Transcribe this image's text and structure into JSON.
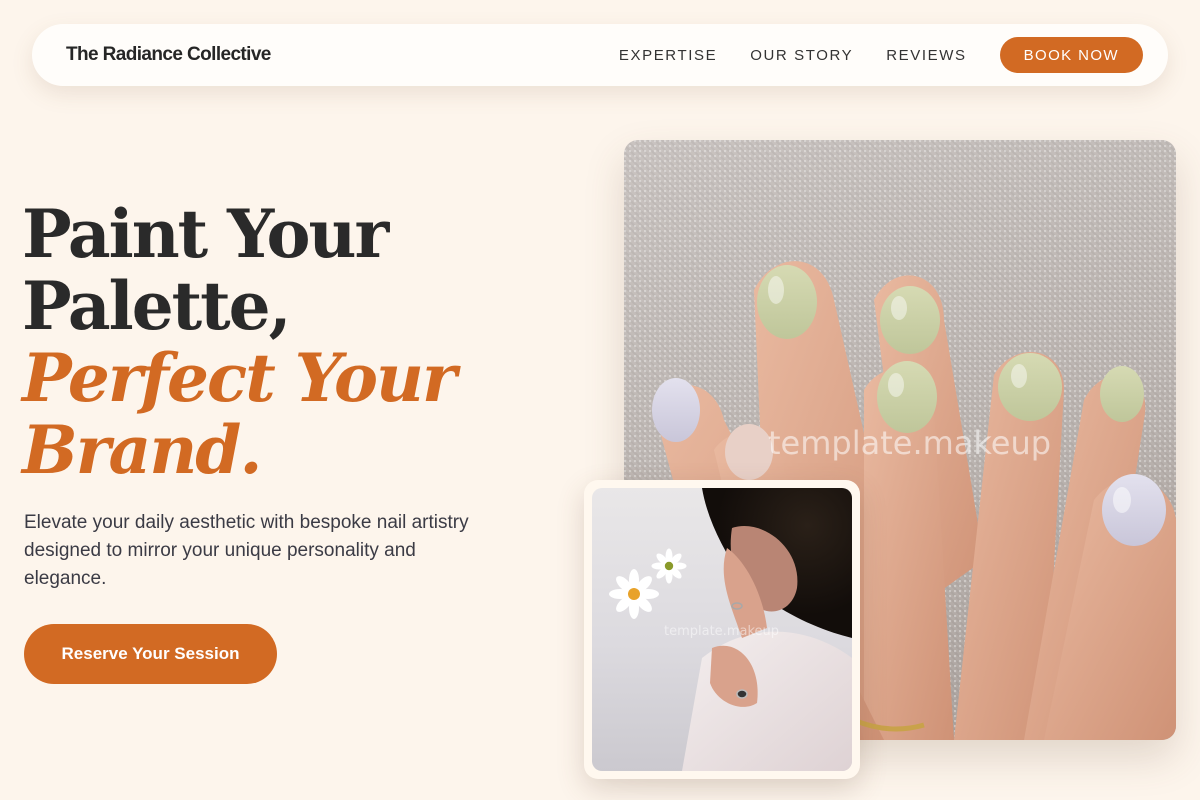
{
  "brand": {
    "name": "The Radiance Collective"
  },
  "nav": {
    "items": [
      {
        "label": "EXPERTISE"
      },
      {
        "label": "OUR STORY"
      },
      {
        "label": "REVIEWS"
      }
    ],
    "cta_label": "BOOK NOW"
  },
  "hero": {
    "title_line1": "Paint Your",
    "title_line2": "Palette,",
    "title_line3": "Perfect Your",
    "title_line4": "Brand.",
    "subtitle": "Elevate your daily aesthetic with bespoke nail artistry designed to mirror your unique personality and elegance.",
    "cta_label": "Reserve Your Session"
  },
  "images": {
    "main_watermark": "template.makeup",
    "inset_watermark": "template.makeup"
  },
  "colors": {
    "accent": "#d26a23",
    "background": "#fdf5ec",
    "text_dark": "#2a2a2a"
  }
}
